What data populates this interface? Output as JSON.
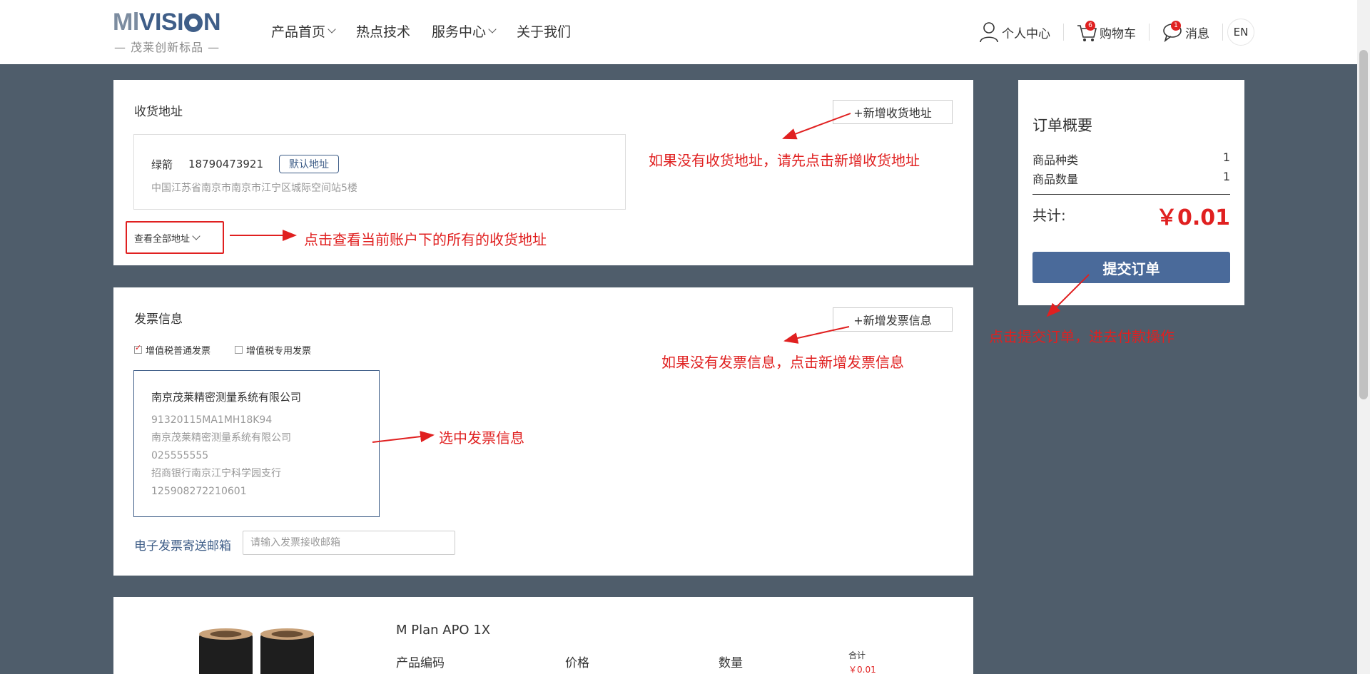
{
  "logo": {
    "brand_left": "Ml",
    "brand_right": "VISI",
    "brand_end": "N",
    "tagline": "— 茂莱创新标品 —"
  },
  "nav": [
    "产品首页",
    "热点技术",
    "服务中心",
    "关于我们"
  ],
  "header_right": {
    "profile": "个人中心",
    "cart": "购物车",
    "cart_count": "6",
    "messages": "消息",
    "message_count": "1",
    "lang": "EN"
  },
  "address": {
    "title": "收货地址",
    "add_button": "+新增收货地址",
    "name": "绿箭",
    "phone": "18790473921",
    "default_tag": "默认地址",
    "detail": "中国江苏省南京市南京市江宁区城际空间站5楼",
    "see_all": "查看全部地址"
  },
  "invoice": {
    "title": "发票信息",
    "add_button": "+新增发票信息",
    "type_normal": "增值税普通发票",
    "type_special": "增值税专用发票",
    "company": "南京茂莱精密测量系统有限公司",
    "tax_id": "91320115MA1MH18K94",
    "address": "南京茂莱精密测量系统有限公司",
    "phone": "025555555",
    "bank": "招商银行南京江宁科学园支行",
    "account": "125908272210601",
    "email_label": "电子发票寄送邮箱",
    "email_placeholder": "请输入发票接收邮箱"
  },
  "product": {
    "name": "M Plan APO 1X",
    "col_code": "产品编码",
    "col_price": "价格",
    "col_qty": "数量",
    "col_total": "合计",
    "total_value": "￥0.01"
  },
  "summary": {
    "title": "订单概要",
    "kinds_label": "商品种类",
    "kinds_value": "1",
    "count_label": "商品数量",
    "count_value": "1",
    "total_label": "共计:",
    "total_value": "￥0.01",
    "submit": "提交订单"
  },
  "annotations": {
    "add_address": "如果没有收货地址，请先点击新增收货地址",
    "see_all": "点击查看当前账户下的所有的收货地址",
    "add_invoice": "如果没有发票信息，点击新增发票信息",
    "select_invoice": "选中发票信息",
    "submit": "点击提交订单，进去付款操作"
  },
  "colors": {
    "accent": "#3f5e88",
    "button": "#4a6a9a",
    "annotation": "#e02020",
    "background": "#4f5d6b"
  }
}
